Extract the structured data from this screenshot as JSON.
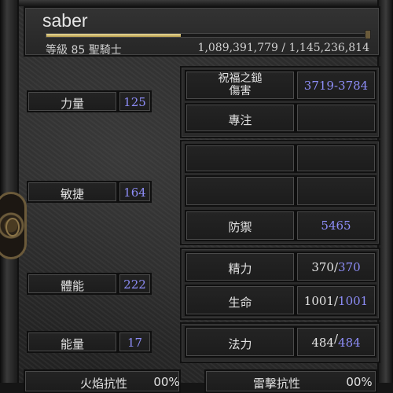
{
  "character": {
    "name": "saber",
    "level_text": "等級 85 聖騎士",
    "xp_text": "1,089,391,779 / 1,145,236,814",
    "xp_fraction": 0.42
  },
  "attributes": {
    "strength": {
      "label": "力量",
      "value": "125"
    },
    "dexterity": {
      "label": "敏捷",
      "value": "164"
    },
    "vitality": {
      "label": "體能",
      "value": "222"
    },
    "energy": {
      "label": "能量",
      "value": "17"
    }
  },
  "combat": {
    "damage": {
      "label": "祝福之鎚\n傷害",
      "value": "3719-3784"
    },
    "focus": {
      "label": "專注",
      "value": ""
    },
    "defense": {
      "label": "防禦",
      "value": "5465"
    }
  },
  "vitals": {
    "stamina": {
      "label": "精力",
      "current": "370",
      "sep": "/",
      "max": "370"
    },
    "life": {
      "label": "生命",
      "current": "1001",
      "sep": "/",
      "max": "1001"
    },
    "mana": {
      "label": "法力",
      "current": "484",
      "sep": "/",
      "max": "484"
    }
  },
  "resistances": {
    "fire": {
      "label": "火焰抗性",
      "value": "00%"
    },
    "lightning": {
      "label": "雷擊抗性",
      "value": "00%"
    }
  },
  "colors": {
    "value_blue": "#8d8df7",
    "xp_gold": "#d8c57a"
  }
}
